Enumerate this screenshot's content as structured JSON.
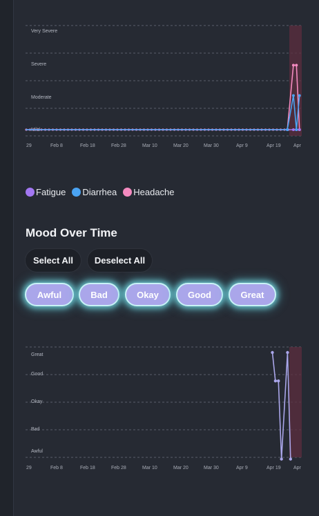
{
  "colors": {
    "fatigue": "#a277f2",
    "diarrhea": "#4aa3f2",
    "headache": "#f48abf",
    "mood": "#aaa6ea",
    "highlight": "#5c2d3f"
  },
  "symptom_chart": {
    "y_labels": [
      "Very Severe",
      "Severe",
      "Moderate",
      "Mild"
    ],
    "x_ticks": [
      "29",
      "Feb 8",
      "Feb 18",
      "Feb 28",
      "Mar 10",
      "Mar 20",
      "Mar 30",
      "Apr 9",
      "Apr 19",
      "Apr"
    ]
  },
  "legend": [
    {
      "label": "Fatigue",
      "color_key": "fatigue"
    },
    {
      "label": "Diarrhea",
      "color_key": "diarrhea"
    },
    {
      "label": "Headache",
      "color_key": "headache"
    }
  ],
  "mood_section": {
    "title": "Mood Over Time",
    "select_all": "Select All",
    "deselect_all": "Deselect All",
    "filters": [
      "Awful",
      "Bad",
      "Okay",
      "Good",
      "Great"
    ]
  },
  "mood_chart": {
    "y_labels": [
      "Great",
      "Good",
      "Okay",
      "Bad",
      "Awful"
    ],
    "x_ticks": [
      "29",
      "Feb 8",
      "Feb 18",
      "Feb 28",
      "Mar 10",
      "Mar 20",
      "Mar 30",
      "Apr 9",
      "Apr 19",
      "Apr"
    ]
  },
  "chart_data": [
    {
      "type": "line",
      "x_domain": [
        "Jan 29",
        "Apr 29"
      ],
      "ylabel": "",
      "y_levels": [
        "None",
        "Mild",
        "Moderate",
        "Severe",
        "Very Severe"
      ],
      "series": [
        {
          "name": "Fatigue",
          "color_key": "fatigue",
          "points": [
            [
              "Jan 29",
              0
            ],
            [
              "Apr 24",
              0
            ],
            [
              "Apr 26",
              0
            ],
            [
              "Apr 27",
              0
            ],
            [
              "Apr 28",
              0
            ]
          ]
        },
        {
          "name": "Diarrhea",
          "color_key": "diarrhea",
          "points": [
            [
              "Jan 29",
              0
            ],
            [
              "Apr 24",
              0
            ],
            [
              "Apr 26",
              2.25
            ],
            [
              "Apr 27",
              0
            ],
            [
              "Apr 28",
              2.25
            ]
          ]
        },
        {
          "name": "Headache",
          "color_key": "headache",
          "points": [
            [
              "Jan 29",
              0
            ],
            [
              "Apr 24",
              0
            ],
            [
              "Apr 26",
              4.25
            ],
            [
              "Apr 27",
              4.25
            ],
            [
              "Apr 28",
              0
            ]
          ]
        }
      ]
    },
    {
      "type": "line",
      "x_domain": [
        "Jan 29",
        "Apr 29"
      ],
      "y_levels": [
        "Awful",
        "Bad",
        "Okay",
        "Good",
        "Great"
      ],
      "series": [
        {
          "name": "Mood",
          "color_key": "mood",
          "points": [
            [
              "Apr 21",
              5
            ],
            [
              "Apr 22",
              4.2
            ],
            [
              "Apr 23",
              4.2
            ],
            [
              "Apr 24",
              2
            ],
            [
              "Apr 26",
              5
            ],
            [
              "Apr 27",
              2
            ]
          ]
        }
      ]
    }
  ]
}
